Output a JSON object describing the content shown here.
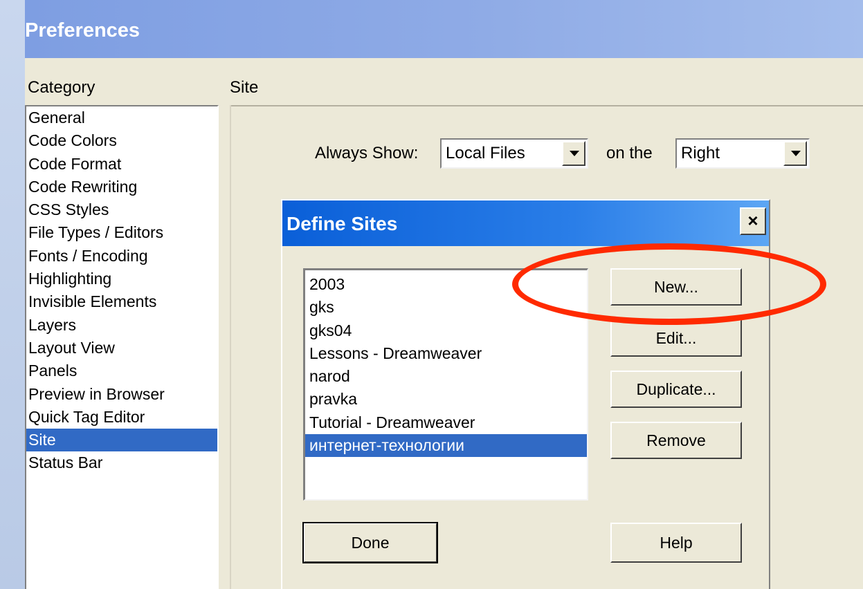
{
  "window": {
    "title": "Preferences"
  },
  "category": {
    "label": "Category",
    "items": [
      "General",
      "Code Colors",
      "Code Format",
      "Code Rewriting",
      "CSS Styles",
      "File Types / Editors",
      "Fonts / Encoding",
      "Highlighting",
      "Invisible Elements",
      "Layers",
      "Layout View",
      "Panels",
      "Preview in Browser",
      "Quick Tag Editor",
      "Site",
      "Status Bar"
    ],
    "selected": "Site"
  },
  "site_panel": {
    "heading": "Site",
    "always_show_label": "Always Show:",
    "always_show_value": "Local Files",
    "on_the_label": "on the",
    "side_value": "Right"
  },
  "define_sites": {
    "title": "Define Sites",
    "close_glyph": "×",
    "sites": [
      "2003",
      "gks",
      "gks04",
      "Lessons - Dreamweaver",
      "narod",
      "pravka",
      "Tutorial - Dreamweaver",
      "интернет-технологии"
    ],
    "selected": "интернет-технологии",
    "buttons": {
      "new": "New...",
      "edit": "Edit...",
      "duplicate": "Duplicate...",
      "remove": "Remove",
      "done": "Done",
      "help": "Help"
    }
  },
  "colors": {
    "selection": "#316ac5",
    "annotation_ring": "#ff2a00",
    "dialog_title": "#0a5fd8"
  }
}
